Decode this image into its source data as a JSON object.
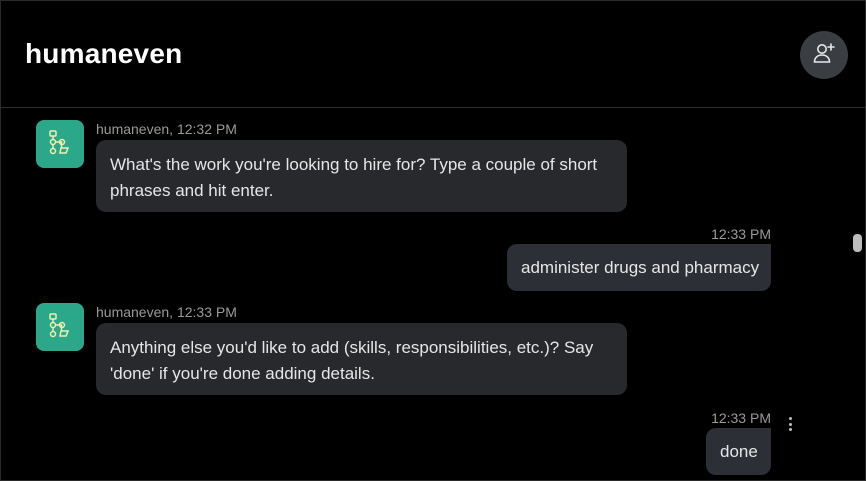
{
  "header": {
    "title": "humaneven",
    "add_person_icon": "add-person-icon"
  },
  "messages": [
    {
      "from": "bot",
      "meta": "humaneven, 12:32 PM",
      "text": "What's the work you're looking to hire for? Type a couple of short phrases and hit enter."
    },
    {
      "from": "user",
      "time": "12:33 PM",
      "text": "administer drugs and pharmacy"
    },
    {
      "from": "bot",
      "meta": "humaneven, 12:33 PM",
      "text": "Anything else you'd like to add (skills, responsibilities, etc.)? Say 'done' if you're done adding details."
    },
    {
      "from": "user",
      "time": "12:33 PM",
      "text": "done"
    }
  ],
  "colors": {
    "background": "#000000",
    "avatar": "#2aa889",
    "bubble_in": "#27292d",
    "bubble_out": "#2c3036"
  }
}
